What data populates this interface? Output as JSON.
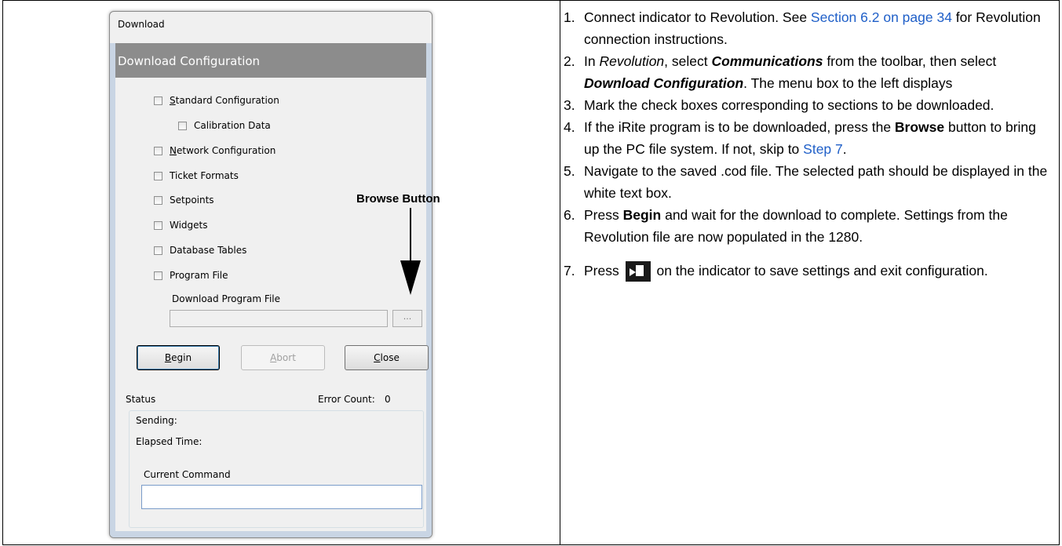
{
  "dialog": {
    "title": "Download",
    "header": "Download Configuration",
    "checkboxes": [
      {
        "pre": "",
        "u": "S",
        "post": "tandard Configuration"
      },
      {
        "pre": "Calibration Data",
        "u": "",
        "post": ""
      },
      {
        "pre": "",
        "u": "N",
        "post": "etwork Configuration"
      },
      {
        "pre": "Ticket Formats",
        "u": "",
        "post": ""
      },
      {
        "pre": "Setpoints",
        "u": "",
        "post": ""
      },
      {
        "pre": "Widgets",
        "u": "",
        "post": ""
      },
      {
        "pre": "Database Tables",
        "u": "",
        "post": ""
      },
      {
        "pre": "Program File",
        "u": "",
        "post": ""
      }
    ],
    "program_file_label": "Download Program File",
    "browse_button": "...",
    "buttons": {
      "begin_u": "B",
      "begin_rest": "egin",
      "abort_u": "A",
      "abort_rest": "bort",
      "close_u": "C",
      "close_rest": "lose"
    },
    "status": {
      "title": "Status",
      "error_count_label": "Error Count:",
      "error_count_value": "0",
      "sending": "Sending:",
      "elapsed": "Elapsed Time:",
      "current_command": "Current Command"
    }
  },
  "callout": {
    "label": "Browse Button"
  },
  "steps": {
    "s1_num": "1.",
    "s1_a": "Connect indicator to Revolution. See ",
    "s1_link": "Section 6.2 on page 34",
    "s1_b": " for Revolution connection instructions.",
    "s2_num": "2.",
    "s2_a": "In ",
    "s2_i": "Revolution",
    "s2_b": ", select ",
    "s2_bi1": "Communications",
    "s2_c": " from the toolbar, then select ",
    "s2_bi2": "Download Configuration",
    "s2_d": ". The menu box to the left displays",
    "s3_num": "3.",
    "s3": "Mark the check boxes corresponding to sections to be downloaded.",
    "s4_num": "4.",
    "s4_a": "If the iRite program is to be downloaded, press the ",
    "s4_b": "Browse",
    "s4_c": " button to bring up the PC file system. If not, skip to ",
    "s4_link": "Step 7",
    "s4_d": ".",
    "s5_num": "5.",
    "s5": "Navigate to the saved .cod file. The selected path should be displayed in the white text box.",
    "s6_num": "6.",
    "s6_a": "Press ",
    "s6_b": "Begin",
    "s6_c": " and wait for the download to complete. Settings from the Revolution file are now populated in the 1280.",
    "s7_num": "7.",
    "s7_a": "Press ",
    "s7_b": " on the indicator to save settings and exit configuration."
  }
}
